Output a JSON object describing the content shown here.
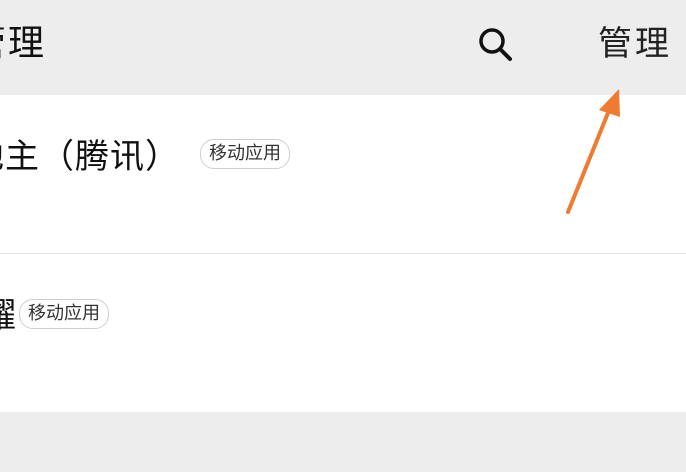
{
  "header": {
    "title": "管理",
    "search_icon": "search-icon",
    "manage_label": "管理"
  },
  "apps": [
    {
      "name": "地主（腾讯）",
      "tag": "移动应用"
    },
    {
      "name": "耀",
      "tag": "移动应用"
    }
  ],
  "annotation": {
    "arrow_color": "#f07a30"
  },
  "colors": {
    "header_bg": "#ededed",
    "list_bg": "#ffffff",
    "divider": "#e2e2e2"
  }
}
